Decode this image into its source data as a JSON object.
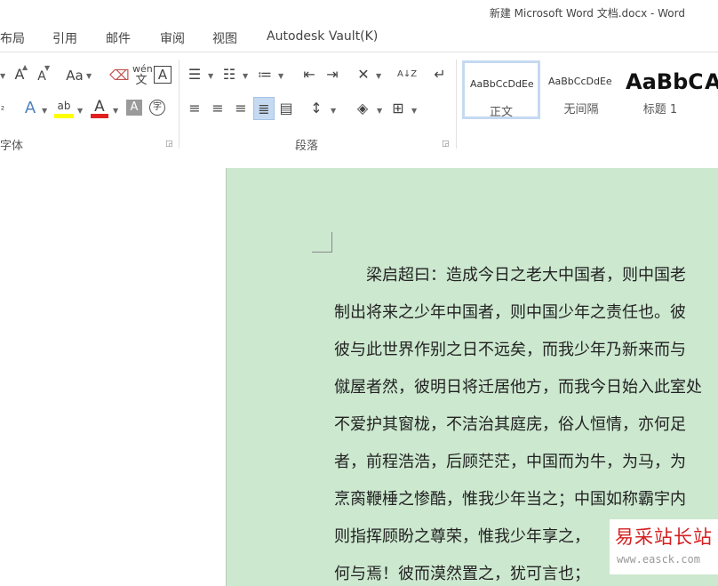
{
  "window": {
    "title": "新建 Microsoft Word 文档.docx - Word"
  },
  "tabs": [
    "布局",
    "引用",
    "邮件",
    "审阅",
    "视图",
    "Autodesk Vault(K)"
  ],
  "ribbon": {
    "font_group": {
      "label": "字体",
      "grow_font": "A",
      "shrink_font": "A",
      "change_case": "Aa",
      "phonetic_top": "wén",
      "phonetic_bottom": "文",
      "char_border": "A",
      "text_effect": "A",
      "highlight": "ab",
      "font_color": "A",
      "char_shading": "A",
      "enclose_char": "字"
    },
    "paragraph_group": {
      "label": "段落",
      "sort": "A↓Z"
    },
    "styles": [
      {
        "sample": "AaBbCcDdEe",
        "name": "正文"
      },
      {
        "sample": "AaBbCcDdEe",
        "name": "无间隔"
      },
      {
        "sample": "AaBbC",
        "name": "标题 1"
      },
      {
        "sample": "A",
        "name": ""
      }
    ]
  },
  "document": {
    "lines": [
      "　　梁启超曰：造成今日之老大中国者，则中国老",
      "制出将来之少年中国者，则中国少年之责任也。彼",
      "彼与此世界作别之日不远矣，而我少年乃新来而与",
      "僦屋者然，彼明日将迁居他方，而我今日始入此室处",
      "不爱护其窗栊，不洁治其庭庑，俗人恒情，亦何足",
      "者，前程浩浩，后顾茫茫，中国而为牛，为马，为",
      "烹脔鞭棰之惨酷，惟我少年当之；中国如称霸宇内",
      "则指挥顾盼之尊荣，惟我少年享之，",
      "何与焉！彼而漠然置之，犹可言也；"
    ]
  },
  "watermark": {
    "text": "易采站长站",
    "url": "www.easck.com"
  }
}
